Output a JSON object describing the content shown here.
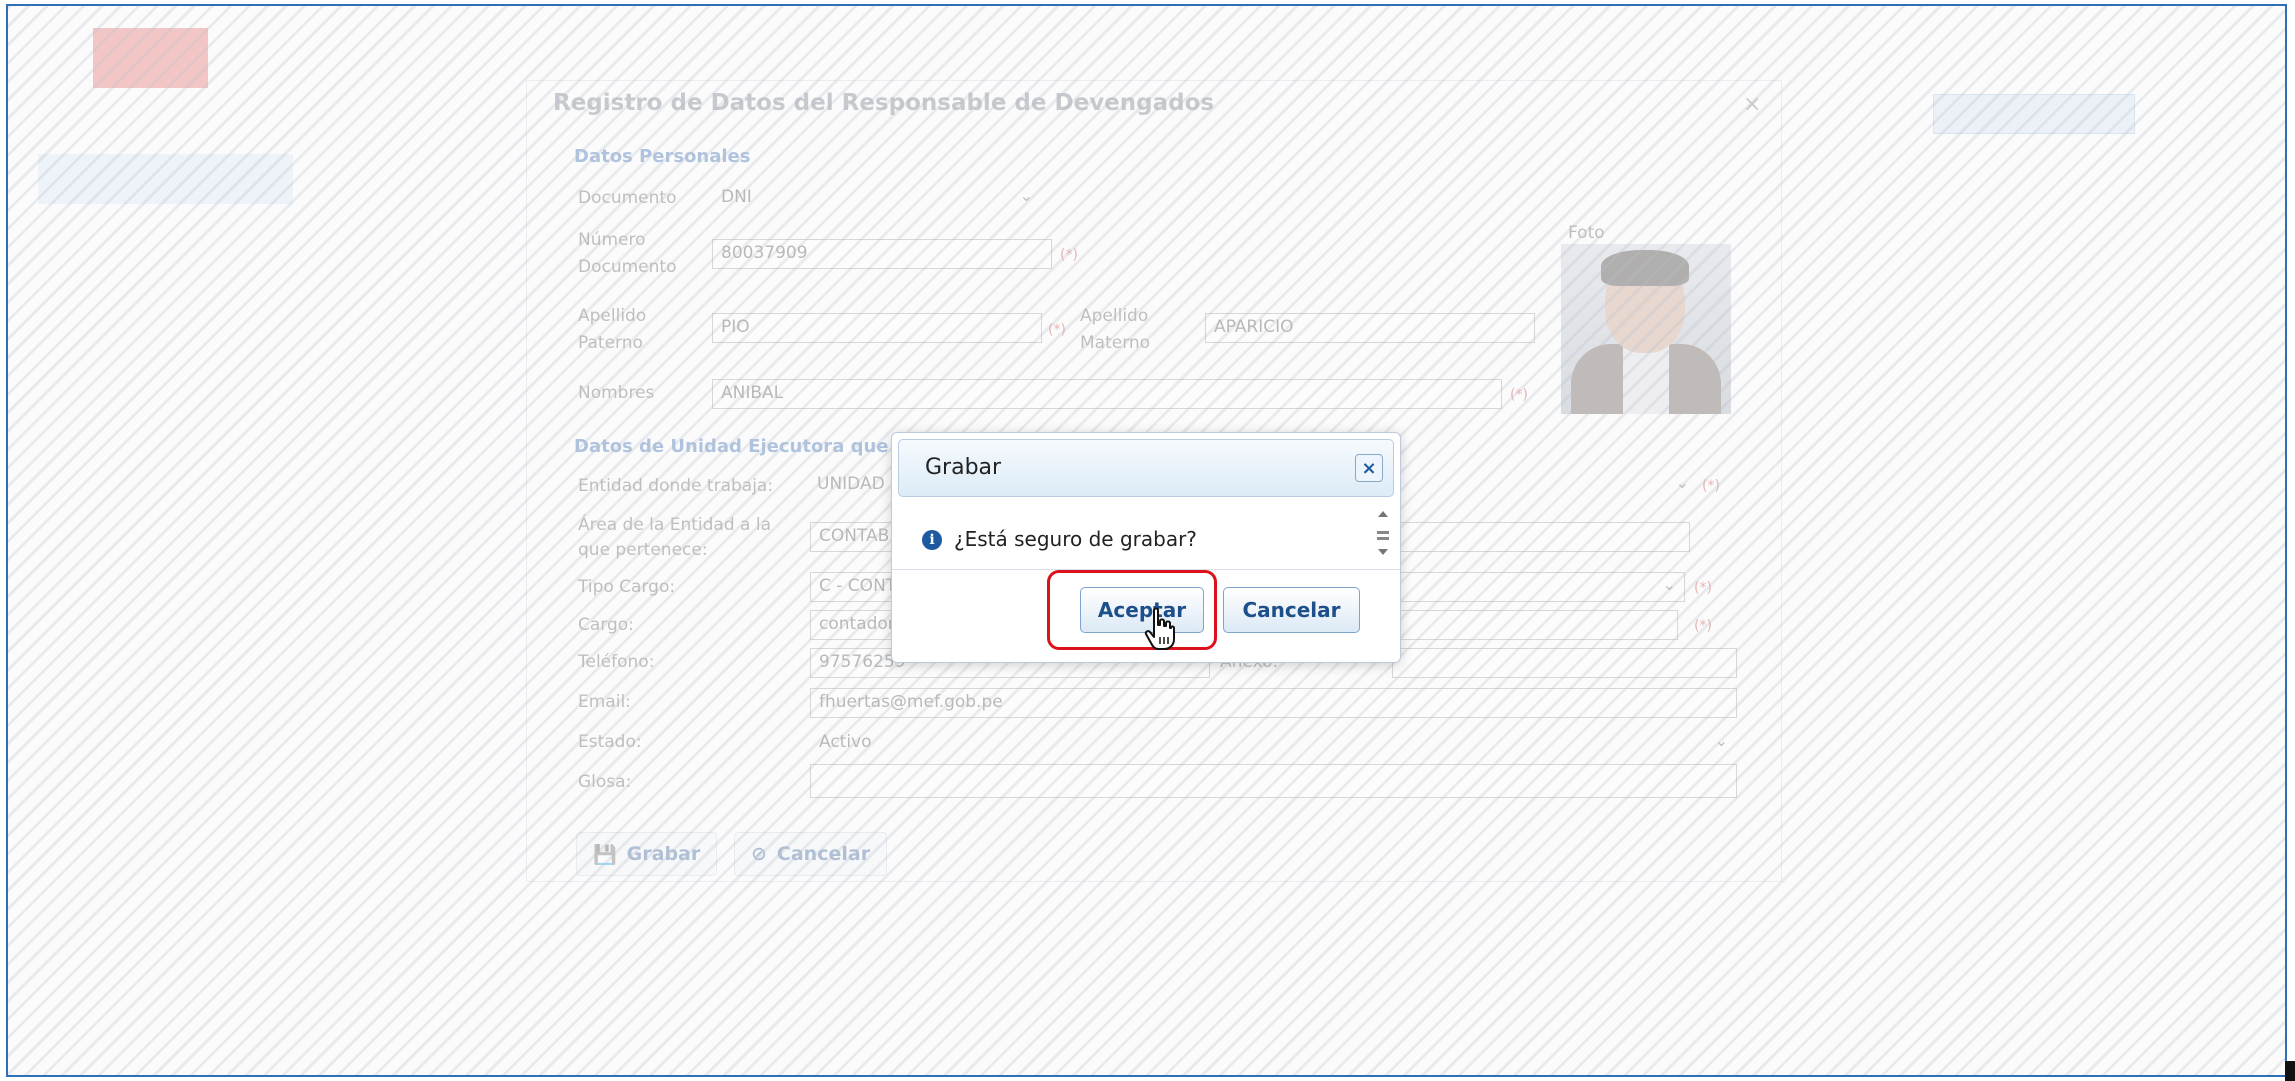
{
  "dialog": {
    "title": "Registro de Datos del Responsable de Devengados",
    "close_label": "×"
  },
  "personal": {
    "section_title": "Datos Personales",
    "documento_label": "Documento",
    "documento_value": "DNI",
    "numero_label_1": "Número",
    "numero_label_2": "Documento",
    "numero_value": "80037909",
    "apellido_paterno_label_1": "Apellido",
    "apellido_paterno_label_2": "Paterno",
    "apellido_paterno_value": "PIO",
    "apellido_materno_label_1": "Apellido",
    "apellido_materno_label_2": "Materno",
    "apellido_materno_value": "APARICIO",
    "nombres_label": "Nombres",
    "nombres_value": "ANIBAL",
    "required_mark": "(*)",
    "foto_label": "Foto"
  },
  "unidad": {
    "section_title": "Datos de Unidad Ejecutora que",
    "entidad_label": "Entidad donde trabaja:",
    "entidad_value": "UNIDAD",
    "area_label_1": "Área de la Entidad a la",
    "area_label_2": "que pertenece:",
    "area_value": "CONTAB",
    "tipo_cargo_label": "Tipo Cargo:",
    "tipo_cargo_value": "C - CONT",
    "cargo_label": "Cargo:",
    "cargo_value": "contador",
    "telefono_label": "Teléfono:",
    "telefono_value": "97576259",
    "anexo_label": "Anexo:",
    "email_label": "Email:",
    "email_value": "fhuertas@mef.gob.pe",
    "estado_label": "Estado:",
    "estado_value": "Activo",
    "glosa_label": "Glosa:"
  },
  "footer": {
    "grabar_label": "Grabar",
    "cancelar_label": "Cancelar"
  },
  "confirm": {
    "title": "Grabar",
    "message": "¿Está seguro de grabar?",
    "accept_label": "Aceptar",
    "cancel_label": "Cancelar",
    "close_label": "×"
  },
  "colors": {
    "accent": "#1d5aa0",
    "highlight": "#d9121c",
    "frame_border": "#2f6fb8"
  },
  "icons": [
    "close-icon",
    "info-icon",
    "save-icon",
    "cancel-icon",
    "chevron-down-icon",
    "hand-cursor-icon"
  ]
}
